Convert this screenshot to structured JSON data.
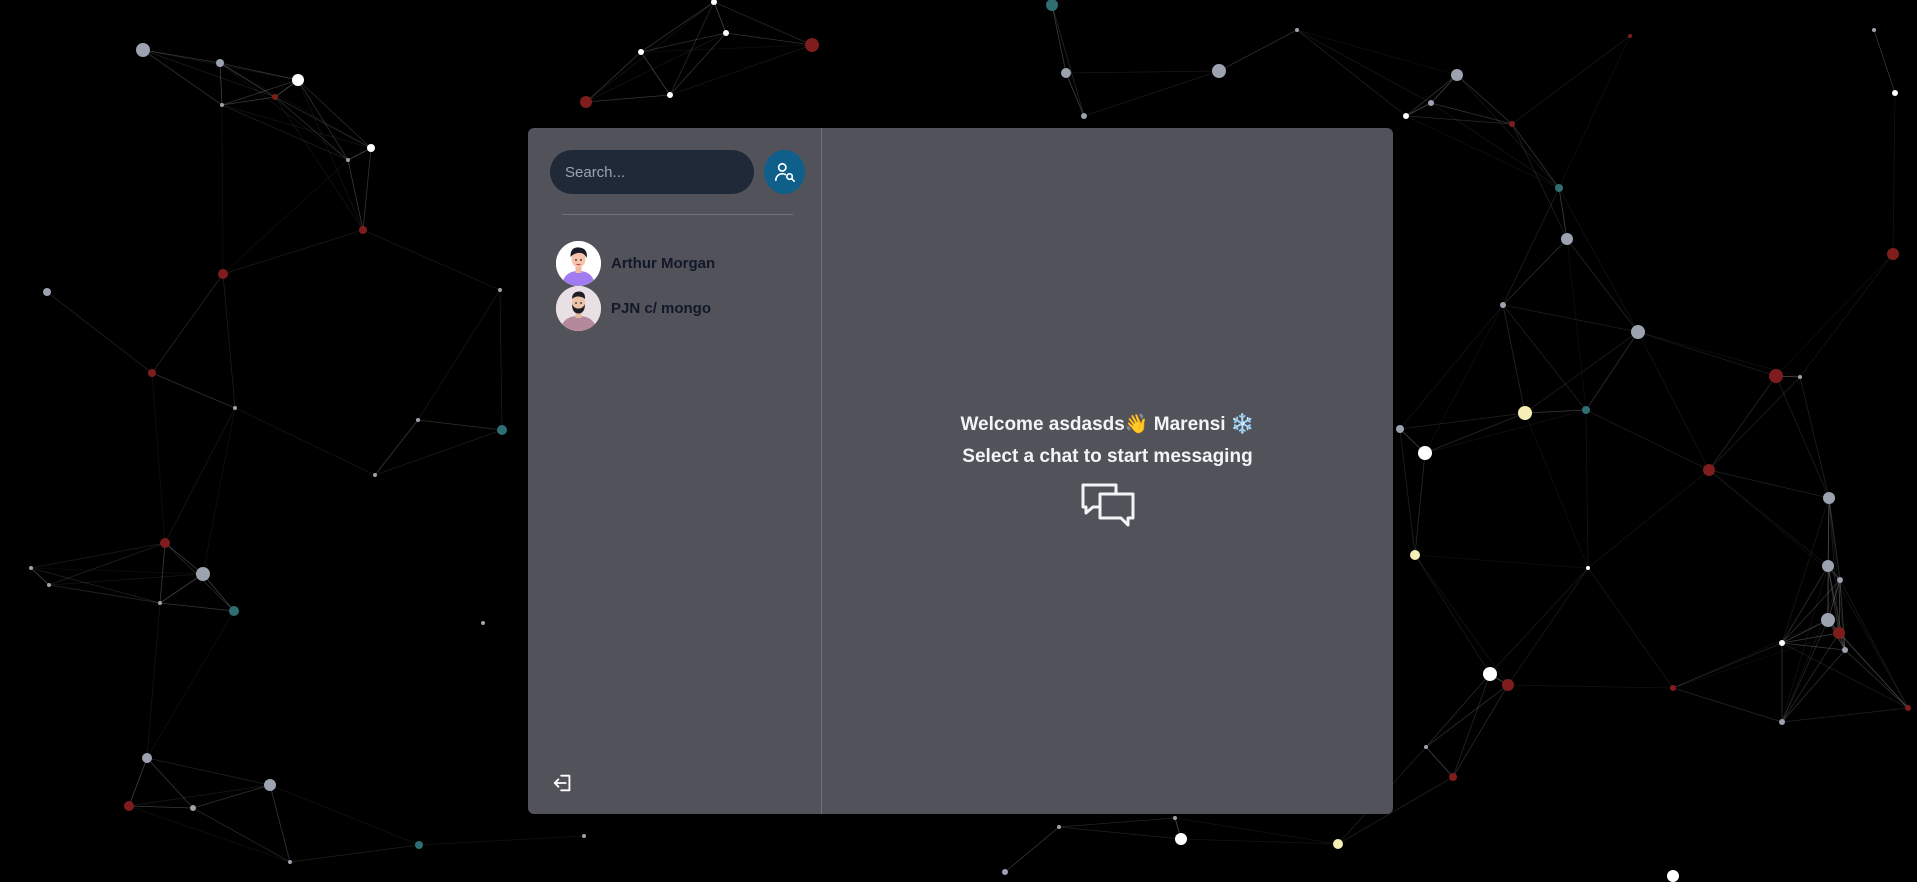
{
  "search": {
    "placeholder": "Search...",
    "value": ""
  },
  "conversations": [
    {
      "name": "Arthur Morgan",
      "avatar": "avatar-female-icon"
    },
    {
      "name": "PJN c/ mongo",
      "avatar": "avatar-male-bearded-icon"
    }
  ],
  "welcome": {
    "line1": "Welcome asdasds👋 Marensi ❄️",
    "line2": "Select a chat to start messaging"
  },
  "icons": {
    "search_button": "user-search-icon",
    "logout": "logout-icon",
    "empty_state": "chat-bubbles-icon"
  },
  "colors": {
    "background": "#000000",
    "panel": "#52525b",
    "search_input": "#1f2937",
    "accent": "#0e5f8a",
    "node_white": "#ffffff",
    "node_gray": "#9ca3af",
    "node_red": "#7f1d1d",
    "node_teal": "#2f6f73",
    "node_yellow": "#f5efb5"
  }
}
